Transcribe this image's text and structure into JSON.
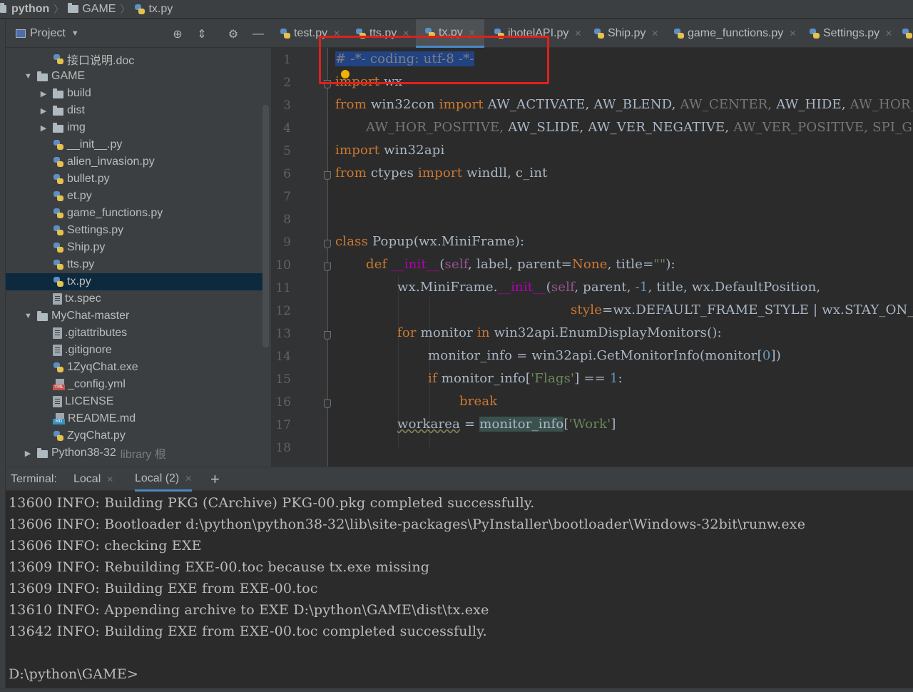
{
  "breadcrumb": {
    "root": "python",
    "folder": "GAME",
    "file": "tx.py"
  },
  "project": {
    "title": "Project",
    "tree": [
      {
        "label": "接口说明.doc",
        "icon": "py",
        "indent": 2,
        "arrow": ""
      },
      {
        "label": "GAME",
        "icon": "folder",
        "indent": 1,
        "arrow": "down"
      },
      {
        "label": "build",
        "icon": "folder",
        "indent": 2,
        "arrow": "right"
      },
      {
        "label": "dist",
        "icon": "folder",
        "indent": 2,
        "arrow": "right"
      },
      {
        "label": "img",
        "icon": "folder",
        "indent": 2,
        "arrow": "right"
      },
      {
        "label": "__init__.py",
        "icon": "py",
        "indent": 2,
        "arrow": ""
      },
      {
        "label": "alien_invasion.py",
        "icon": "py",
        "indent": 2,
        "arrow": ""
      },
      {
        "label": "bullet.py",
        "icon": "py",
        "indent": 2,
        "arrow": ""
      },
      {
        "label": "et.py",
        "icon": "py",
        "indent": 2,
        "arrow": ""
      },
      {
        "label": "game_functions.py",
        "icon": "py",
        "indent": 2,
        "arrow": ""
      },
      {
        "label": "Settings.py",
        "icon": "py",
        "indent": 2,
        "arrow": ""
      },
      {
        "label": "Ship.py",
        "icon": "py",
        "indent": 2,
        "arrow": ""
      },
      {
        "label": "tts.py",
        "icon": "py",
        "indent": 2,
        "arrow": ""
      },
      {
        "label": "tx.py",
        "icon": "py",
        "indent": 2,
        "arrow": "",
        "selected": true
      },
      {
        "label": "tx.spec",
        "icon": "file",
        "indent": 2,
        "arrow": ""
      },
      {
        "label": "MyChat-master",
        "icon": "folder",
        "indent": 1,
        "arrow": "down"
      },
      {
        "label": ".gitattributes",
        "icon": "file",
        "indent": 2,
        "arrow": ""
      },
      {
        "label": ".gitignore",
        "icon": "file",
        "indent": 2,
        "arrow": ""
      },
      {
        "label": "1ZyqChat.exe",
        "icon": "py",
        "indent": 2,
        "arrow": ""
      },
      {
        "label": "_config.yml",
        "icon": "yml",
        "indent": 2,
        "arrow": ""
      },
      {
        "label": "LICENSE",
        "icon": "file",
        "indent": 2,
        "arrow": ""
      },
      {
        "label": "README.md",
        "icon": "md",
        "indent": 2,
        "arrow": ""
      },
      {
        "label": "ZyqChat.py",
        "icon": "py",
        "indent": 2,
        "arrow": ""
      },
      {
        "label": "Python38-32",
        "icon": "folder",
        "indent": 1,
        "arrow": "right",
        "extra": "library 根"
      }
    ]
  },
  "editor": {
    "tabs": [
      "test.py",
      "tts.py",
      "tx.py",
      "ihotelAPI.py",
      "Ship.py",
      "game_functions.py",
      "Settings.py"
    ],
    "active_tab": "tx.py",
    "line_numbers": [
      "1",
      "2",
      "3",
      "4",
      "5",
      "6",
      "7",
      "8",
      "9",
      "10",
      "11",
      "12",
      "13",
      "14",
      "15",
      "16",
      "17",
      "18"
    ],
    "code": {
      "l1": "# -*- coding: utf-8 -*-",
      "l2_kw": "import",
      "l2_rest": " wx",
      "l3_from": "from",
      "l3_mod": " win32con ",
      "l3_import": "import",
      "l3_a": " AW_ACTIVATE, AW_BLEND, ",
      "l3_b": "AW_CENTER, ",
      "l3_c": "AW_HIDE, ",
      "l3_d": "AW_HOR_NEG",
      "l4_a": "AW_HOR_POSITIVE, ",
      "l4_b": "AW_SLIDE, AW_VER_NEGATIVE, ",
      "l4_c": "AW_VER_POSITIVE, SPI_GETWO",
      "l5_kw": "import",
      "l5_rest": " win32api",
      "l6_from": "from",
      "l6_mod": " ctypes ",
      "l6_import": "import",
      "l6_rest": " windll, c_int",
      "l9_kw": "class",
      "l9_rest": " Popup(wx.MiniFrame):",
      "l10_def": "def",
      "l10_init": "__init__",
      "l10_a": "(",
      "l10_self": "self",
      "l10_b": ", label, parent=",
      "l10_none": "None",
      "l10_c": ", title=",
      "l10_str": "\"\"",
      "l10_d": "):",
      "l11_a": "wx.MiniFrame.",
      "l11_init": "__init__",
      "l11_b": "(",
      "l11_self": "self",
      "l11_c": ", parent, ",
      "l11_num": "-1",
      "l11_d": ", title, wx.DefaultPosition,",
      "l12_style": "style",
      "l12_rest": "=wx.DEFAULT_FRAME_STYLE | wx.STAY_ON_TO",
      "l13_for": "for",
      "l13_a": " monitor ",
      "l13_in": "in",
      "l13_b": " win32api.EnumDisplayMonitors():",
      "l14_a": "monitor_info = win32api.GetMonitorInfo(monitor[",
      "l14_num": "0",
      "l14_b": "])",
      "l15_if": "if",
      "l15_a": " monitor_info[",
      "l15_str": "'Flags'",
      "l15_b": "] == ",
      "l15_num": "1",
      "l15_c": ":",
      "l16": "break",
      "l17_a": "workarea",
      "l17_b": " = ",
      "l17_c": "monitor_info",
      "l17_d": "[",
      "l17_str": "'Work'",
      "l17_e": "]"
    }
  },
  "terminal": {
    "label": "Terminal:",
    "tabs": [
      "Local",
      "Local (2)"
    ],
    "add": "+",
    "lines": [
      "13600 INFO: Building PKG (CArchive) PKG-00.pkg completed successfully.",
      "13606 INFO: Bootloader d:\\python\\python38-32\\lib\\site-packages\\PyInstaller\\bootloader\\Windows-32bit\\runw.exe",
      "13606 INFO: checking EXE",
      "13609 INFO: Rebuilding EXE-00.toc because tx.exe missing",
      "13609 INFO: Building EXE from EXE-00.toc",
      "13610 INFO: Appending archive to EXE D:\\python\\GAME\\dist\\tx.exe",
      "13642 INFO: Building EXE from EXE-00.toc completed successfully."
    ],
    "prompt": "D:\\python\\GAME>"
  },
  "colors": {
    "highlight_box": "#e0201b",
    "selection": "#214283",
    "keyword": "#cc7832"
  }
}
